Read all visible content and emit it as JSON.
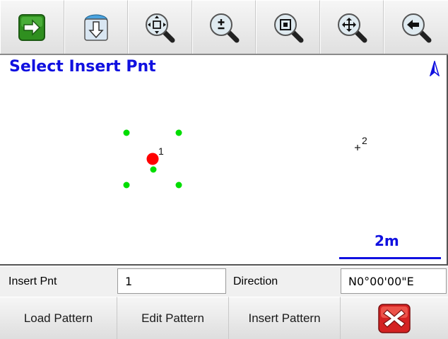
{
  "toolbar": {
    "buttons": [
      {
        "name": "forward-icon"
      },
      {
        "name": "download-map-icon"
      },
      {
        "name": "zoom-extents-icon"
      },
      {
        "name": "zoom-in-out-icon"
      },
      {
        "name": "zoom-window-icon"
      },
      {
        "name": "pan-icon"
      },
      {
        "name": "back-arrow-icon"
      }
    ]
  },
  "map": {
    "title": "Select Insert Pnt",
    "north_icon": "north-arrow-icon",
    "points": [
      {
        "label": "1",
        "selected": true,
        "color": "#ff0000"
      },
      {
        "label": "2",
        "selected": false,
        "color": "#222222"
      }
    ],
    "scale_label": "2m",
    "colors": {
      "title": "#1010e0",
      "pattern_dots": "#00dd00",
      "selected_point": "#ff0000"
    }
  },
  "form": {
    "insert_pnt_label": "Insert Pnt",
    "insert_pnt_value": "1",
    "direction_label": "Direction",
    "direction_value": "N0°00'00\"E"
  },
  "actions": {
    "load_pattern": "Load Pattern",
    "edit_pattern": "Edit Pattern",
    "insert_pattern": "Insert Pattern",
    "close_icon": "close-icon"
  }
}
